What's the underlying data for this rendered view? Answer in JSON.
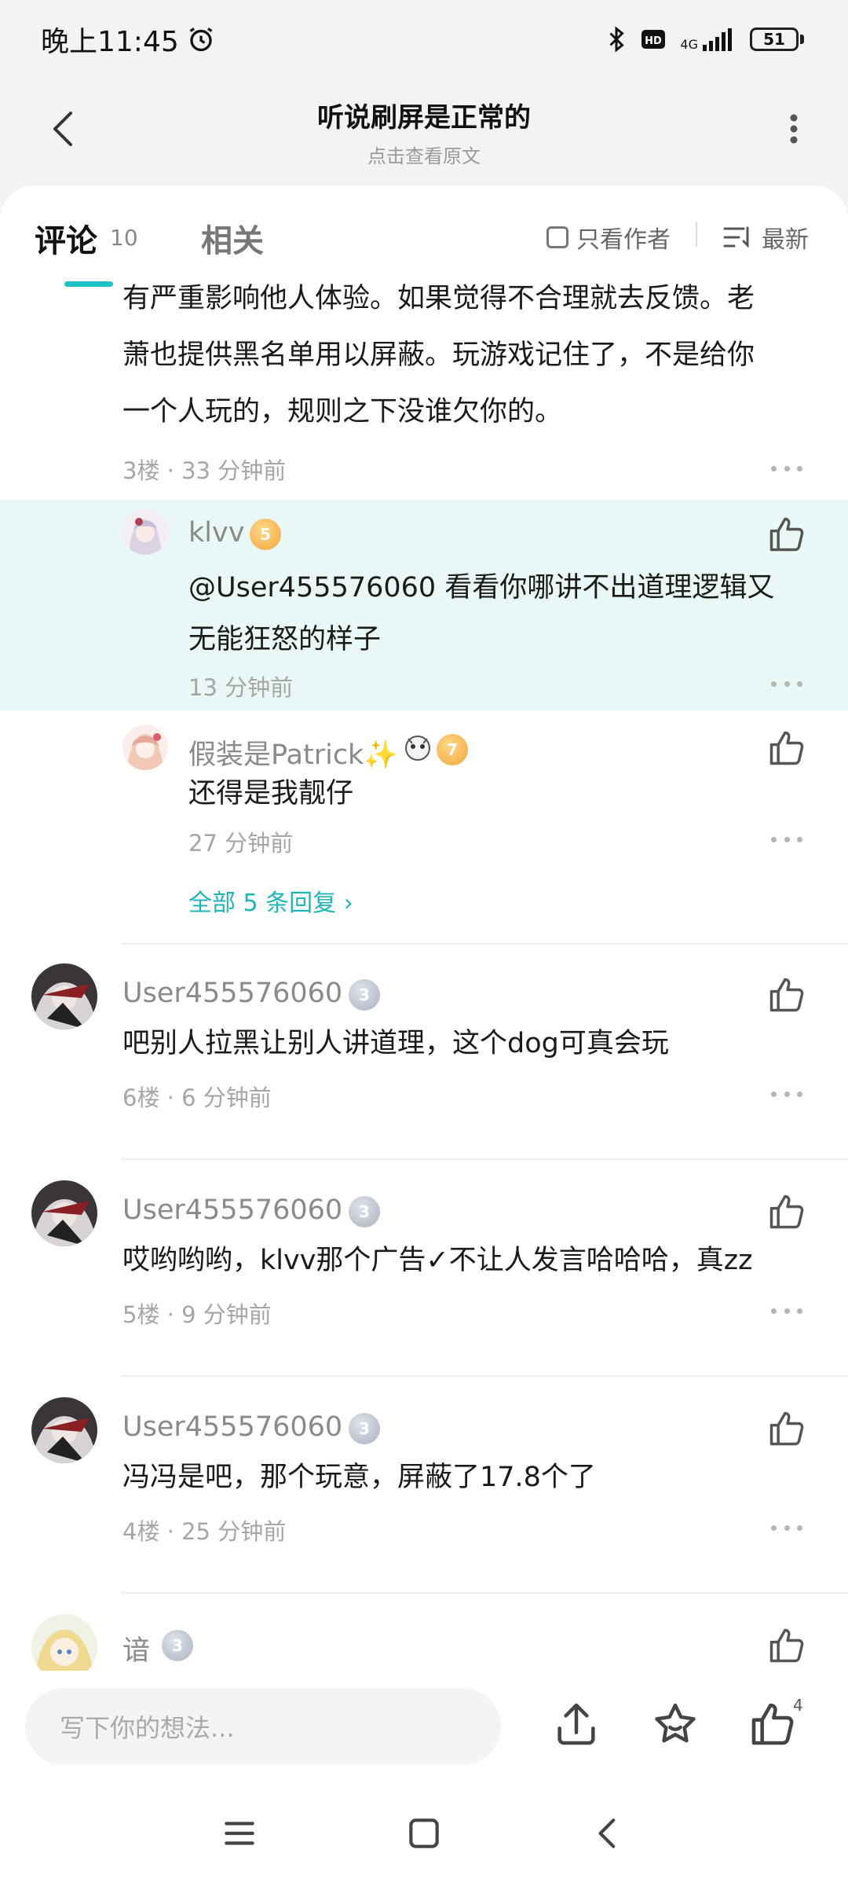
{
  "status": {
    "time": "晚上11:45",
    "battery": "51",
    "network": "4G"
  },
  "header": {
    "title": "听说刷屏是正常的",
    "subtitle": "点击查看原文"
  },
  "tabs": {
    "comments_label": "评论",
    "comments_count": "10",
    "related_label": "相关",
    "author_only_label": "只看作者",
    "sort_label": "最新"
  },
  "colors": {
    "accent": "#1fc3c6",
    "highlight_bg": "#e9f7f7"
  },
  "floor3": {
    "text_lines": [
      "有严重影响他人体验。如果觉得不合理就去反馈。老",
      "萧也提供黑名单用以屏蔽。玩游戏记住了，不是给你",
      "一个人玩的，规则之下没谁欠你的。"
    ],
    "meta": "3楼 · 33 分钟前"
  },
  "replies": [
    {
      "user": "klvv",
      "level": "5",
      "text_lines": [
        "@User455576060  看看你哪讲不出道理逻辑又",
        "无能狂怒的样子"
      ],
      "time": "13 分钟前"
    },
    {
      "user": "假装是Patrick✨",
      "level": "7",
      "text_lines": [
        "还得是我靓仔"
      ],
      "time": "27 分钟前"
    }
  ],
  "all_replies_label": "全部 5 条回复 ›",
  "comments": [
    {
      "user": "User455576060",
      "level": "3",
      "text": "吧别人拉黑让别人讲道理，这个dog可真会玩",
      "meta": "6楼 · 6 分钟前"
    },
    {
      "user": "User455576060",
      "level": "3",
      "text": "哎哟哟哟，klvv那个广告✓不让人发言哈哈哈，真zz",
      "meta": "5楼 · 9 分钟前"
    },
    {
      "user": "User455576060",
      "level": "3",
      "text": "冯冯是吧，那个玩意，屏蔽了17.8个了",
      "meta": "4楼 · 25 分钟前"
    },
    {
      "user": "谙",
      "level": "3"
    }
  ],
  "bottom": {
    "input_placeholder": "写下你的想法...",
    "like_count": "4"
  },
  "icons": {
    "back": "back-arrow-icon",
    "more": "more-vertical-icon",
    "like": "thumbs-up-icon",
    "share": "share-icon",
    "star": "star-icon"
  }
}
